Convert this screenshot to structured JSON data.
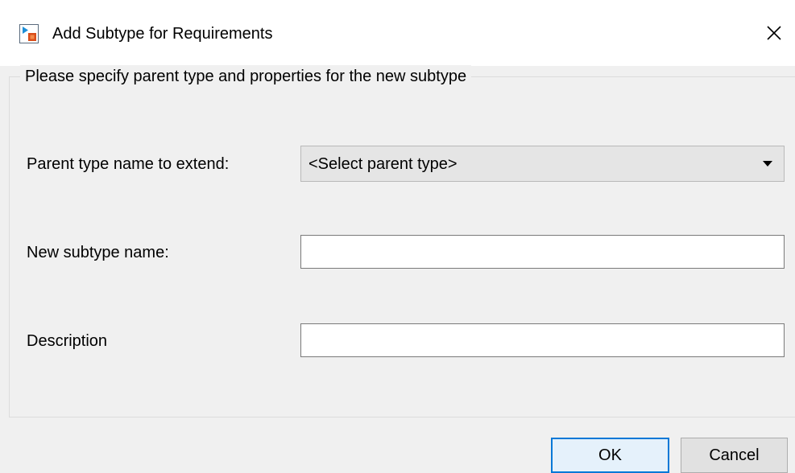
{
  "window": {
    "title": "Add Subtype for Requirements",
    "app_icon": "requirements-app-icon",
    "close_icon": "close-icon"
  },
  "group": {
    "legend": "Please specify parent type and properties for the new subtype"
  },
  "fields": {
    "parent_type_label": "Parent type name to extend:",
    "parent_type_value": "<Select parent type>",
    "subtype_name_label": "New subtype name:",
    "subtype_name_value": "",
    "description_label": "Description",
    "description_value": ""
  },
  "buttons": {
    "ok_label": "OK",
    "cancel_label": "Cancel"
  },
  "colors": {
    "dialog_background": "#f0f0f0",
    "default_button_border": "#0078d7"
  }
}
